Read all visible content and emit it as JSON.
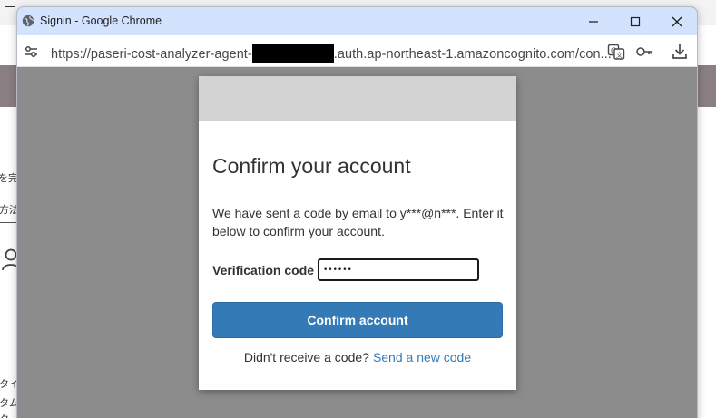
{
  "window": {
    "title": "Signin - Google Chrome",
    "controls": {
      "minimize": "minimize-icon",
      "maximize": "maximize-icon",
      "close": "close-icon"
    }
  },
  "address_bar": {
    "url_prefix": "https://paseri-cost-analyzer-agent-",
    "url_suffix": ".auth.ap-northeast-1.amazoncognito.com/con...",
    "icons": [
      "site-info-icon",
      "translate-icon",
      "password-key-icon",
      "download-icon"
    ]
  },
  "background_page": {
    "text_fragments": [
      "を完",
      "方法",
      "タイ",
      "タム",
      "ク"
    ]
  },
  "modal": {
    "title": "Confirm your account",
    "message": "We have sent a code by email to y***@n***. Enter it below to confirm your account.",
    "verification_label": "Verification code",
    "verification_value": "••••••",
    "confirm_button": "Confirm account",
    "resend_prompt": "Didn't receive a code?",
    "resend_link": "Send a new code"
  },
  "colors": {
    "titlebar": "#d3e3fd",
    "overlay": "#8c8c8c",
    "primary_button": "#337ab7",
    "link": "#337ab7",
    "modal_header": "#d3d3d3"
  }
}
